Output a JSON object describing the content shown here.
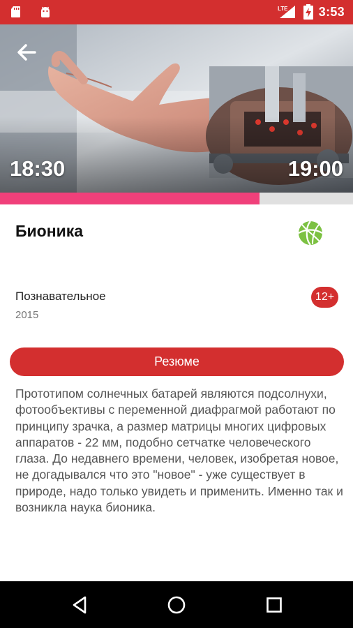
{
  "status_bar": {
    "time": "3:53",
    "network": "LTE",
    "background_color": "#d32f2f",
    "icons": [
      "sd-card-icon",
      "android-icon",
      "lte-signal-icon",
      "battery-charging-icon"
    ]
  },
  "hero": {
    "time_start": "18:30",
    "time_end": "19:00",
    "back_icon": "arrow-back-icon"
  },
  "progress": {
    "fraction": 0.735,
    "fill_color": "#f0407a"
  },
  "program": {
    "title": "Бионика",
    "genre": "Познавательное",
    "year": "2015",
    "age_rating": "12+",
    "channel_logo": "zhivaya-planeta-logo-icon",
    "description": "Прототипом солнечных батарей являются подсолнухи, фотообъективы с переменной диафрагмой работают по принципу зрачка, а размер матрицы многих цифровых аппаратов - 22 мм, подобно сетчатке человеческого глаза. До недавнего времени, человек, изобретая новое, не догадывался что это \"новое\" - уже существует в природе, надо только увидеть и применить. Именно так и возникла наука бионика."
  },
  "actions": {
    "resume_label": "Резюме"
  },
  "nav_bar": {
    "icons": [
      "back-triangle-icon",
      "home-circle-icon",
      "recents-square-icon"
    ]
  }
}
